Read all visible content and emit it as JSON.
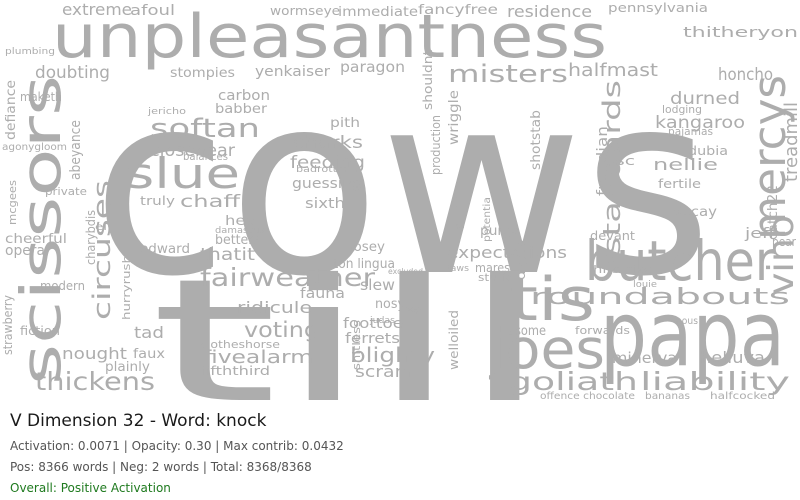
{
  "title": "V Dimension 32 - Word: knock",
  "stats": {
    "activation_line": "Activation: 0.0071 | Opacity: 0.30 | Max contrib: 0.0432",
    "counts_line": "Pos: 8366 words | Neg: 2 words | Total: 8368/8368"
  },
  "overall": {
    "text": "Overall: Positive Activation",
    "color": "#1f7a1f"
  },
  "colors": {
    "word": "#adadad",
    "background": "#ffffff"
  },
  "words": [
    {
      "text": "cows"
    },
    {
      "text": "till"
    },
    {
      "text": "unpleasantness"
    },
    {
      "text": "papa"
    },
    {
      "text": "butcher"
    },
    {
      "text": "tis"
    },
    {
      "text": "scissors"
    },
    {
      "text": "joes"
    },
    {
      "text": "slue"
    },
    {
      "text": "mercys"
    },
    {
      "text": "vino"
    },
    {
      "text": "fairweather"
    },
    {
      "text": "softan"
    },
    {
      "text": "standards"
    },
    {
      "text": "roundabouts"
    },
    {
      "text": "liability"
    },
    {
      "text": "goliath"
    },
    {
      "text": "thickens"
    },
    {
      "text": "misters"
    },
    {
      "text": "circuses"
    },
    {
      "text": "extreme"
    },
    {
      "text": "residence"
    },
    {
      "text": "voting"
    },
    {
      "text": "fivealarm"
    },
    {
      "text": "blighty"
    },
    {
      "text": "halfmast"
    },
    {
      "text": "durned"
    },
    {
      "text": "honcho"
    },
    {
      "text": "thitheryon"
    },
    {
      "text": "kangaroo"
    },
    {
      "text": "nellie"
    },
    {
      "text": "treadmill"
    },
    {
      "text": "sharks"
    },
    {
      "text": "feeding"
    },
    {
      "text": "closenear"
    },
    {
      "text": "chaff"
    },
    {
      "text": "nought"
    },
    {
      "text": "scram"
    },
    {
      "text": "helluva"
    },
    {
      "text": "minerva"
    },
    {
      "text": "ridicule"
    },
    {
      "text": "expectations"
    },
    {
      "text": "doubting"
    },
    {
      "text": "paragon"
    },
    {
      "text": "yenkaiser"
    },
    {
      "text": "stompies"
    },
    {
      "text": "freudian"
    },
    {
      "text": "decay"
    },
    {
      "text": "fertile"
    },
    {
      "text": "catch22"
    },
    {
      "text": "jeff"
    },
    {
      "text": "pear"
    },
    {
      "text": "opera"
    },
    {
      "text": "cheerful"
    },
    {
      "text": "defiance"
    },
    {
      "text": "strawberry"
    },
    {
      "text": "fiction"
    },
    {
      "text": "modern"
    },
    {
      "text": "charybdis"
    },
    {
      "text": "hurryrush"
    },
    {
      "text": "thatit"
    },
    {
      "text": "edward"
    },
    {
      "text": "betters"
    },
    {
      "text": "tad"
    },
    {
      "text": "faux"
    },
    {
      "text": "plainly"
    },
    {
      "text": "clotheshorse"
    },
    {
      "text": "fifththird"
    },
    {
      "text": "ferrets"
    },
    {
      "text": "foottoe"
    },
    {
      "text": "fauna"
    },
    {
      "text": "slew"
    },
    {
      "text": "nosy"
    },
    {
      "text": "nosey"
    },
    {
      "text": "iton lingua"
    },
    {
      "text": "shitless"
    },
    {
      "text": "welloiled"
    },
    {
      "text": "asome"
    },
    {
      "text": "digits"
    },
    {
      "text": "mares"
    },
    {
      "text": "potentia"
    },
    {
      "text": "grinnin"
    },
    {
      "text": "production"
    },
    {
      "text": "shouldnt"
    },
    {
      "text": "shotstab"
    },
    {
      "text": "abeyance"
    },
    {
      "text": "afoul"
    },
    {
      "text": "wormseye"
    },
    {
      "text": "immediate"
    },
    {
      "text": "fancyfree"
    },
    {
      "text": "pennsylvania"
    },
    {
      "text": "carbon"
    },
    {
      "text": "babber"
    },
    {
      "text": "pith"
    },
    {
      "text": "guessing"
    },
    {
      "text": "sixth"
    },
    {
      "text": "wriggle"
    },
    {
      "text": "purge"
    },
    {
      "text": "devant"
    },
    {
      "text": "hitstrike"
    },
    {
      "text": "dubia"
    },
    {
      "text": "sc"
    },
    {
      "text": "heal"
    },
    {
      "text": "truly"
    },
    {
      "text": "balances"
    },
    {
      "text": "maketh"
    },
    {
      "text": "mcgees"
    },
    {
      "text": "private"
    },
    {
      "text": "agonygloom"
    },
    {
      "text": "stuffe"
    },
    {
      "text": "forwards"
    },
    {
      "text": "offence chocolate"
    },
    {
      "text": "bananas"
    },
    {
      "text": "halfcocked"
    },
    {
      "text": "badrotten"
    },
    {
      "text": "lodging"
    },
    {
      "text": "pajamas"
    },
    {
      "text": "plumbing"
    },
    {
      "text": "jericho"
    },
    {
      "text": "el"
    },
    {
      "text": "damascus"
    },
    {
      "text": "nous"
    },
    {
      "text": "louie"
    },
    {
      "text": "taws"
    },
    {
      "text": "bop"
    },
    {
      "text": "judas"
    },
    {
      "text": "excluded"
    }
  ]
}
